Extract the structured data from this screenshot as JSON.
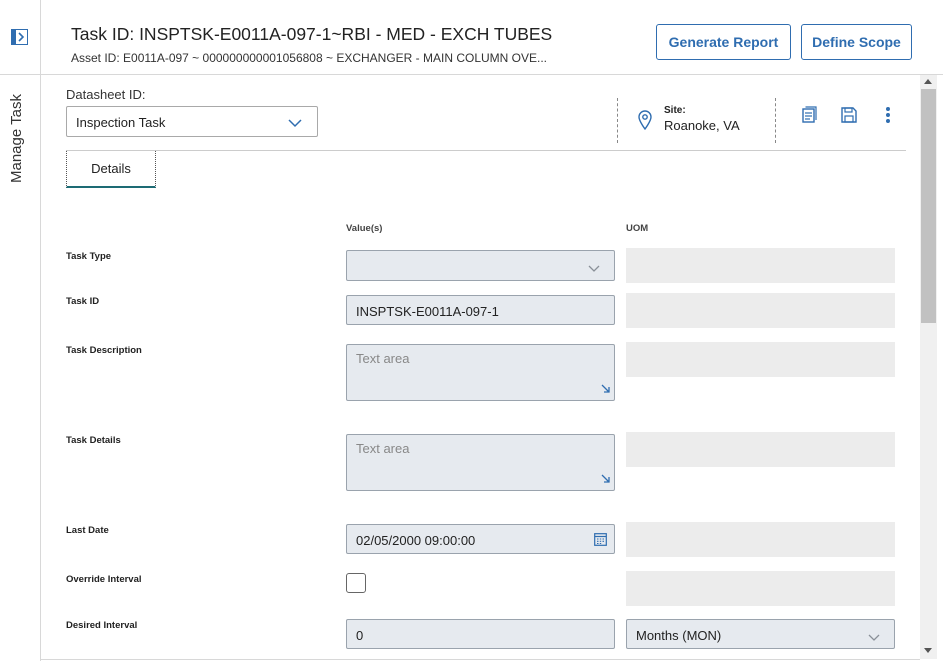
{
  "sidebar": {
    "vertical_label": "Manage Task"
  },
  "header": {
    "title": "Task ID: INSPTSK-E0011A-097-1~RBI - MED - EXCH TUBES",
    "subtitle": "Asset ID: E0011A-097 ~ 000000000001056808 ~ EXCHANGER - MAIN COLUMN OVE...",
    "buttons": {
      "generate_report": "Generate Report",
      "define_scope": "Define Scope"
    }
  },
  "datasheet": {
    "label": "Datasheet ID:",
    "selected": "Inspection Task"
  },
  "site": {
    "label": "Site:",
    "value": "Roanoke, VA"
  },
  "tabs": [
    {
      "label": "Details"
    }
  ],
  "columns": {
    "values": "Value(s)",
    "uom": "UOM"
  },
  "rows": {
    "task_type": {
      "label": "Task Type",
      "value": ""
    },
    "task_id": {
      "label": "Task ID",
      "value": "INSPTSK-E0011A-097-1"
    },
    "task_description": {
      "label": "Task Description",
      "placeholder": "Text area"
    },
    "task_details": {
      "label": "Task Details",
      "placeholder": "Text area"
    },
    "last_date": {
      "label": "Last Date",
      "value": "02/05/2000 09:00:00"
    },
    "override_interval": {
      "label": "Override Interval",
      "checked": false
    },
    "desired_interval": {
      "label": "Desired Interval",
      "value": "0",
      "uom": "Months (MON)"
    }
  },
  "colors": {
    "accent": "#2f6db0",
    "tab_underline": "#1d6b74",
    "field_bg": "#e6eaef",
    "uom_bg": "#ececec"
  },
  "icons": [
    "expand-panel-icon",
    "location-pin-icon",
    "document-icon",
    "save-icon",
    "more-vertical-icon",
    "chevron-down-icon",
    "calendar-icon",
    "resize-handle-icon"
  ]
}
